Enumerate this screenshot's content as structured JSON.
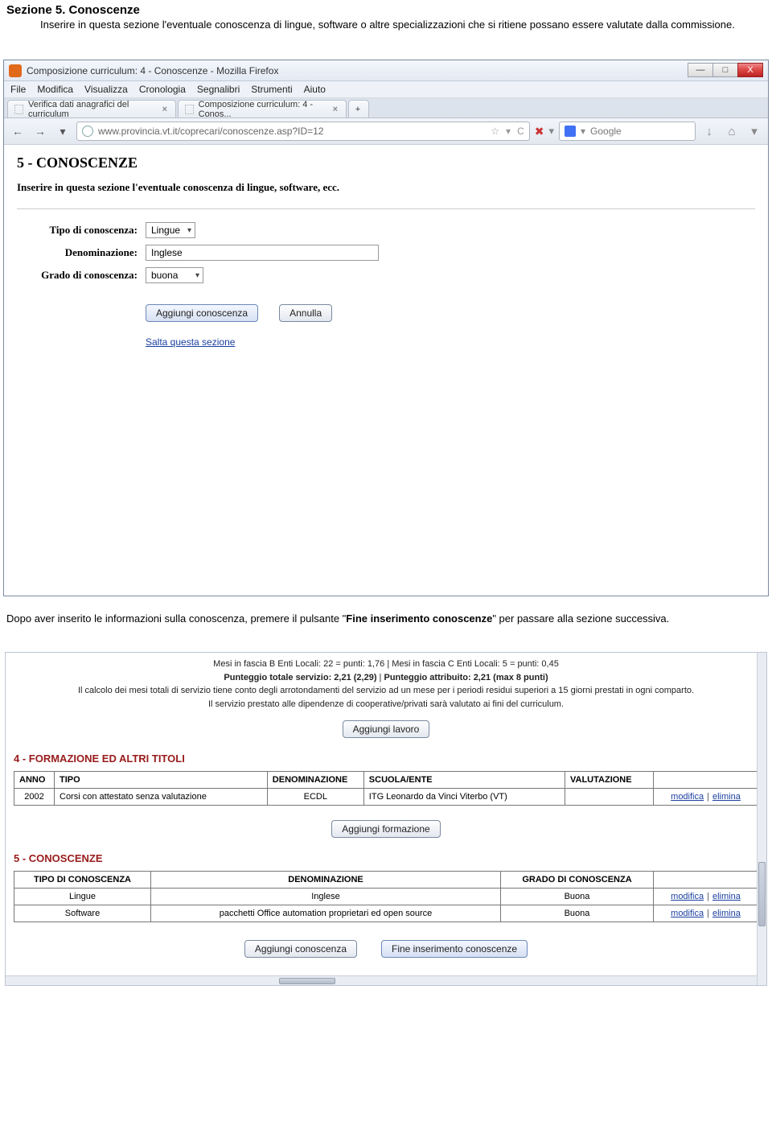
{
  "doc": {
    "title": "Sezione 5. Conoscenze",
    "body_prefix": "Inserire in questa sezione l'eventuale conoscenza di lingue, software o altre specializzazioni che si ritiene possano essere valutate dalla commissione.",
    "mid_text_prefix": "Dopo aver inserito le informazioni sulla conoscenza, premere il pulsante \"",
    "mid_text_bold": "Fine inserimento conoscenze",
    "mid_text_suffix": "\" per passare alla sezione successiva."
  },
  "browser": {
    "window_title": "Composizione curriculum: 4 - Conoscenze - Mozilla Firefox",
    "win_buttons": {
      "min": "—",
      "max": "□",
      "close": "X"
    },
    "menu": [
      "File",
      "Modifica",
      "Visualizza",
      "Cronologia",
      "Segnalibri",
      "Strumenti",
      "Aiuto"
    ],
    "tabs": [
      {
        "label": "Verifica dati anagrafici del curriculum",
        "closeable": true
      },
      {
        "label": "Composizione curriculum: 4 - Conos...",
        "closeable": true
      }
    ],
    "new_tab": "+",
    "nav": {
      "back": "←",
      "fwd": "→",
      "reload": "⟳",
      "history_drop": "▾"
    },
    "url": "www.provincia.vt.it/coprecari/conoscenze.asp?ID=12",
    "urlbar_icons": {
      "star": "☆",
      "drop": "▾",
      "refresh": "C"
    },
    "search_placeholder": "Google",
    "toolbar_icons": {
      "dl": "↓",
      "home": "⌂",
      "menu": "▾"
    }
  },
  "page": {
    "heading": "5 - CONOSCENZE",
    "subheading": "Inserire in questa sezione l'eventuale conoscenza di lingue, software, ecc.",
    "fields": {
      "tipo_label": "Tipo di conoscenza:",
      "tipo_value": "Lingue",
      "denom_label": "Denominazione:",
      "denom_value": "Inglese",
      "grado_label": "Grado di conoscenza:",
      "grado_value": "buona"
    },
    "buttons": {
      "add": "Aggiungi conoscenza",
      "cancel": "Annulla"
    },
    "skip_link": "Salta questa sezione"
  },
  "panel2": {
    "score": {
      "line1": "Mesi in fascia B Enti Locali: 22 = punti: 1,76   |   Mesi in fascia C Enti Locali: 5 = punti: 0,45",
      "line2_a": "Punteggio totale servizio: 2,21 (2,29)",
      "line2_sep": "   |   ",
      "line2_b": "Punteggio attribuito: 2,21 (max 8 punti)",
      "line3": "Il calcolo dei mesi totali di servizio tiene conto degli arrotondamenti del servizio ad un mese per i periodi residui superiori a 15 giorni prestati in ogni comparto.",
      "line4": "Il servizio prestato alle dipendenze di cooperative/privati sarà valutato ai fini del curriculum."
    },
    "btn_add_lavoro": "Aggiungi lavoro",
    "sect4_title": "4 - FORMAZIONE ED ALTRI TITOLI",
    "table4": {
      "headers": [
        "ANNO",
        "TIPO",
        "DENOMINAZIONE",
        "SCUOLA/ENTE",
        "VALUTAZIONE",
        ""
      ],
      "rows": [
        {
          "anno": "2002",
          "tipo": "Corsi con attestato senza valutazione",
          "denom": "ECDL",
          "scuola": "ITG Leonardo da Vinci Viterbo (VT)",
          "valut": ""
        }
      ],
      "action_edit": "modifica",
      "action_del": "elimina"
    },
    "btn_add_formazione": "Aggiungi formazione",
    "sect5_title": "5 - CONOSCENZE",
    "table5": {
      "headers": [
        "TIPO DI CONOSCENZA",
        "DENOMINAZIONE",
        "GRADO DI CONOSCENZA",
        ""
      ],
      "rows": [
        {
          "tipo": "Lingue",
          "denom": "Inglese",
          "grado": "Buona"
        },
        {
          "tipo": "Software",
          "denom": "pacchetti Office automation proprietari ed open source",
          "grado": "Buona"
        }
      ],
      "action_edit": "modifica",
      "action_del": "elimina"
    },
    "btn_add_conoscenza": "Aggiungi conoscenza",
    "btn_fine": "Fine inserimento conoscenze"
  }
}
